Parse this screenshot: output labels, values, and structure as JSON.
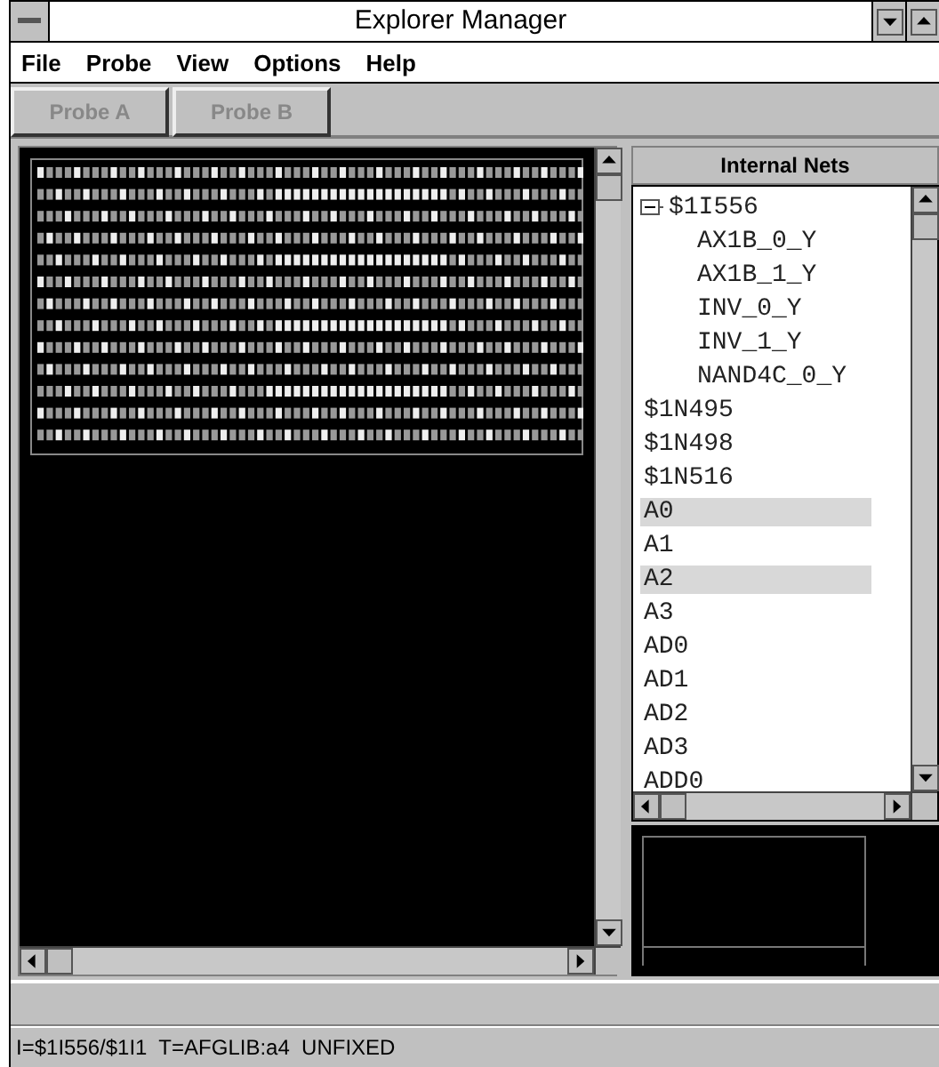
{
  "window": {
    "title": "Explorer Manager"
  },
  "menu": [
    "File",
    "Probe",
    "View",
    "Options",
    "Help"
  ],
  "toolbar": [
    {
      "label": "Probe A",
      "disabled": true
    },
    {
      "label": "Probe B",
      "disabled": true
    }
  ],
  "nets_panel": {
    "title": "Internal Nets",
    "items": [
      {
        "label": "$1I556",
        "expanded": true,
        "selected": false,
        "children": [
          {
            "label": "AX1B_0_Y",
            "selected": false
          },
          {
            "label": "AX1B_1_Y",
            "selected": false
          },
          {
            "label": "INV_0_Y",
            "selected": false
          },
          {
            "label": "INV_1_Y",
            "selected": false
          },
          {
            "label": "NAND4C_0_Y",
            "selected": false
          }
        ]
      },
      {
        "label": "$1N495",
        "selected": false
      },
      {
        "label": "$1N498",
        "selected": false
      },
      {
        "label": "$1N516",
        "selected": false
      },
      {
        "label": "A0",
        "selected": true
      },
      {
        "label": "A1",
        "selected": false
      },
      {
        "label": "A2",
        "selected": true
      },
      {
        "label": "A3",
        "selected": false
      },
      {
        "label": "AD0",
        "selected": false
      },
      {
        "label": "AD1",
        "selected": false
      },
      {
        "label": "AD2",
        "selected": false
      },
      {
        "label": "AD3",
        "selected": false
      },
      {
        "label": "ADD0",
        "selected": false
      }
    ]
  },
  "status_bar": "I=$1I556/$1I1  T=AFGLIB:a4  UNFIXED"
}
